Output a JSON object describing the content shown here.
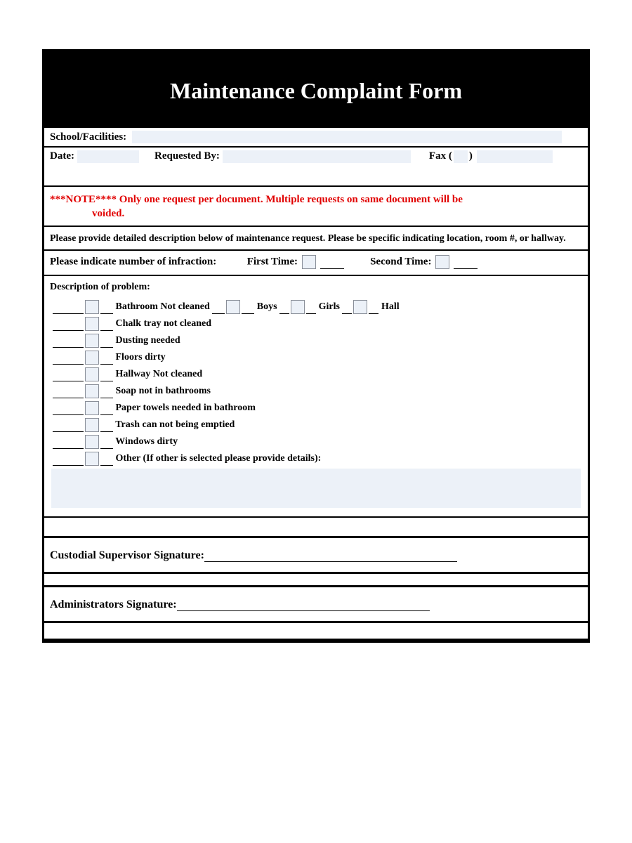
{
  "title": "Maintenance Complaint Form",
  "labels": {
    "school": "School/Facilities:",
    "date": "Date:",
    "requested_by": "Requested By:",
    "fax": "Fax (",
    "fax_close": ")"
  },
  "note_line1": "***NOTE**** Only one request per document. Multiple requests on same document will be",
  "note_line2": "voided.",
  "instructions": "Please provide detailed description below of maintenance request. Please be specific indicating location, room #, or hallway.",
  "infraction": {
    "label": "Please indicate number of infraction:",
    "first": "First Time:",
    "second": "Second Time:"
  },
  "problems_label": "Description of problem:",
  "problems": [
    "Bathroom Not cleaned",
    "Chalk tray not cleaned",
    "Dusting needed",
    "Floors dirty",
    "Hallway Not cleaned",
    "Soap not in bathrooms",
    "Paper towels needed in bathroom",
    "Trash can not being emptied",
    "Windows dirty",
    "Other (If other is selected please provide details):"
  ],
  "bathroom_sub": {
    "boys": "Boys",
    "girls": "Girls",
    "hall": "Hall"
  },
  "signatures": {
    "custodial": "Custodial Supervisor Signature:",
    "admin": "Administrators Signature:"
  }
}
